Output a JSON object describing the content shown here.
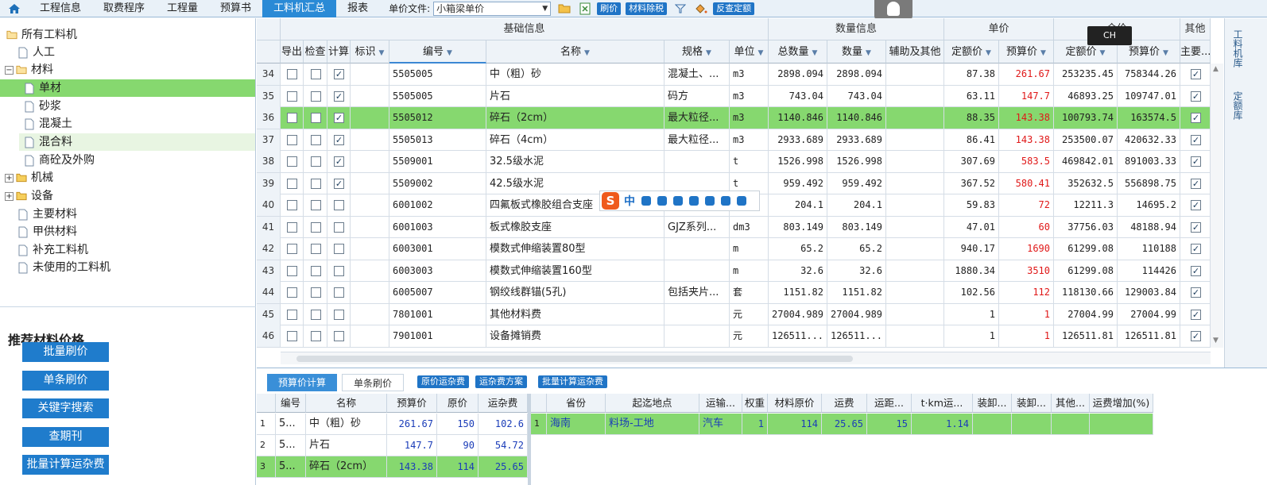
{
  "topbar": {
    "tabs": [
      "工程信息",
      "取费程序",
      "工程量",
      "预算书",
      "工料机汇总",
      "报表"
    ],
    "active_tab": "工料机汇总",
    "file_label": "单价文件:",
    "file_value": "小箱梁单价",
    "buttons": [
      "刷价",
      "材料除税",
      "反查定额"
    ]
  },
  "tree": {
    "items": [
      "所有工料机",
      "人工",
      "材料",
      "单材",
      "砂浆",
      "混凝土",
      "混合料",
      "商砼及外购",
      "机械",
      "设备",
      "主要材料",
      "甲供材料",
      "补充工料机",
      "未使用的工料机"
    ],
    "expander_minus": "−",
    "expander_plus": "+"
  },
  "recommend": {
    "title": "推荐材料价格",
    "buttons": [
      "批量刷价",
      "单条刷价",
      "关键字搜索",
      "查期刊",
      "批量计算运杂费"
    ]
  },
  "grid": {
    "groups": [
      "基础信息",
      "数量信息",
      "单价",
      "合价",
      "其他"
    ],
    "columns": [
      "导出",
      "检查",
      "计算",
      "标识",
      "编号",
      "名称",
      "规格",
      "单位",
      "总数量",
      "数量",
      "辅助及其他",
      "定额价",
      "预算价",
      "定额价",
      "预算价",
      "主要..."
    ],
    "rows": [
      {
        "n": "34",
        "calc": true,
        "code": "5505005",
        "name": "中（粗）砂",
        "spec": "混凝土、...",
        "unit": "m3",
        "total": "2898.094",
        "qty": "2898.094",
        "dp": "87.38",
        "bp": "261.67",
        "dt": "253235.45",
        "bt": "758344.26"
      },
      {
        "n": "35",
        "calc": true,
        "code": "5505005",
        "name": "片石",
        "spec": "码方",
        "unit": "m3",
        "total": "743.04",
        "qty": "743.04",
        "dp": "63.11",
        "bp": "147.7",
        "dt": "46893.25",
        "bt": "109747.01"
      },
      {
        "n": "36",
        "calc": true,
        "code": "5505012",
        "name": "碎石（2cm）",
        "spec": "最大粒径...",
        "unit": "m3",
        "total": "1140.846",
        "qty": "1140.846",
        "dp": "88.35",
        "bp": "143.38",
        "dt": "100793.74",
        "bt": "163574.5"
      },
      {
        "n": "37",
        "calc": true,
        "code": "5505013",
        "name": "碎石（4cm）",
        "spec": "最大粒径...",
        "unit": "m3",
        "total": "2933.689",
        "qty": "2933.689",
        "dp": "86.41",
        "bp": "143.38",
        "dt": "253500.07",
        "bt": "420632.33"
      },
      {
        "n": "38",
        "calc": true,
        "code": "5509001",
        "name": "32.5级水泥",
        "spec": "",
        "unit": "t",
        "total": "1526.998",
        "qty": "1526.998",
        "dp": "307.69",
        "bp": "583.5",
        "dt": "469842.01",
        "bt": "891003.33"
      },
      {
        "n": "39",
        "calc": true,
        "code": "5509002",
        "name": "42.5级水泥",
        "spec": "",
        "unit": "t",
        "total": "959.492",
        "qty": "959.492",
        "dp": "367.52",
        "bp": "580.41",
        "dt": "352632.5",
        "bt": "556898.75"
      },
      {
        "n": "40",
        "calc": false,
        "code": "6001002",
        "name": "四氟板式橡胶组合支座",
        "spec": "",
        "unit": "",
        "total": "204.1",
        "qty": "204.1",
        "dp": "59.83",
        "bp": "72",
        "dt": "12211.3",
        "bt": "14695.2"
      },
      {
        "n": "41",
        "calc": false,
        "code": "6001003",
        "name": "板式橡胶支座",
        "spec": "GJZ系列...",
        "unit": "dm3",
        "total": "803.149",
        "qty": "803.149",
        "dp": "47.01",
        "bp": "60",
        "dt": "37756.03",
        "bt": "48188.94"
      },
      {
        "n": "42",
        "calc": false,
        "code": "6003001",
        "name": "模数式伸缩装置80型",
        "spec": "",
        "unit": "m",
        "total": "65.2",
        "qty": "65.2",
        "dp": "940.17",
        "bp": "1690",
        "dt": "61299.08",
        "bt": "110188"
      },
      {
        "n": "43",
        "calc": false,
        "code": "6003003",
        "name": "模数式伸缩装置160型",
        "spec": "",
        "unit": "m",
        "total": "32.6",
        "qty": "32.6",
        "dp": "1880.34",
        "bp": "3510",
        "dt": "61299.08",
        "bt": "114426"
      },
      {
        "n": "44",
        "calc": false,
        "code": "6005007",
        "name": "钢绞线群锚(5孔)",
        "spec": "包括夹片...",
        "unit": "套",
        "total": "1151.82",
        "qty": "1151.82",
        "dp": "102.56",
        "bp": "112",
        "dt": "118130.66",
        "bt": "129003.84"
      },
      {
        "n": "45",
        "calc": false,
        "code": "7801001",
        "name": "其他材料费",
        "spec": "",
        "unit": "元",
        "total": "27004.989",
        "qty": "27004.989",
        "dp": "1",
        "bp": "1",
        "dt": "27004.99",
        "bt": "27004.99"
      },
      {
        "n": "46",
        "calc": false,
        "code": "7901001",
        "name": "设备摊销费",
        "spec": "",
        "unit": "元",
        "total": "126511...",
        "qty": "126511...",
        "dp": "1",
        "bp": "1",
        "dt": "126511.81",
        "bt": "126511.81"
      }
    ],
    "selected_row": "36",
    "check_mark": "✓"
  },
  "ime": {
    "logo": "S",
    "mode": "中",
    "indicator": "CH"
  },
  "right_tabs": [
    "工料机库",
    "定额库"
  ],
  "bottom": {
    "tabs": [
      "预算价计算",
      "单条刷价"
    ],
    "buttons": [
      "原价运杂费",
      "运杂费方案",
      "批量计算运杂费"
    ],
    "left_columns": [
      "编号",
      "名称",
      "预算价",
      "原价",
      "运杂费"
    ],
    "left_rows": [
      {
        "n": "1",
        "code": "5...",
        "name": "中（粗）砂",
        "bp": "261.67",
        "op": "150",
        "fee": "102.6"
      },
      {
        "n": "2",
        "code": "5...",
        "name": "片石",
        "bp": "147.7",
        "op": "90",
        "fee": "54.72"
      },
      {
        "n": "3",
        "code": "5...",
        "name": "碎石（2cm）",
        "bp": "143.38",
        "op": "114",
        "fee": "25.65"
      }
    ],
    "right_columns": [
      "省份",
      "起迄地点",
      "运输...",
      "权重",
      "材料原价",
      "运费",
      "运距...",
      "t·km运...",
      "装卸...",
      "装卸...",
      "其他...",
      "运费增加(%)"
    ],
    "right_row": {
      "n": "1",
      "prov": "海南",
      "place": "料场-工地",
      "trans": "汽车",
      "weight": "1",
      "orig": "114",
      "fee": "25.65",
      "dist": "15",
      "tkm": "1.14"
    }
  }
}
